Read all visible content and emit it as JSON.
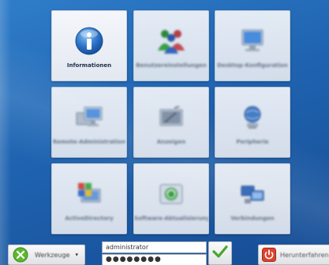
{
  "tiles": [
    {
      "label": "Informationen",
      "icon": "info-icon",
      "active": true
    },
    {
      "label": "Benutzereinstellungen",
      "icon": "users-icon"
    },
    {
      "label": "Desktop-Konfiguration",
      "icon": "monitor-icon"
    },
    {
      "label": "Remote-Administration",
      "icon": "remote-monitor-icon"
    },
    {
      "label": "Anzeigen",
      "icon": "display-icon"
    },
    {
      "label": "Peripherie",
      "icon": "globe-device-icon"
    },
    {
      "label": "ActiveDirectory",
      "icon": "directory-icon"
    },
    {
      "label": "Software-Aktualisierung",
      "icon": "update-icon"
    },
    {
      "label": "Verbindungen",
      "icon": "network-icon"
    }
  ],
  "toolbar": {
    "tools_label": "Werkzeuge",
    "tools_caret": "▾",
    "username": "administrator",
    "password_mask": "●●●●●●●●",
    "login_icon": "checkmark-icon",
    "shutdown_label": "Herunterfahren"
  },
  "colors": {
    "background": "#1f63b0",
    "accent_green": "#5cb82e",
    "shutdown_red": "#d9432f",
    "info_blue": "#2d73c8"
  }
}
